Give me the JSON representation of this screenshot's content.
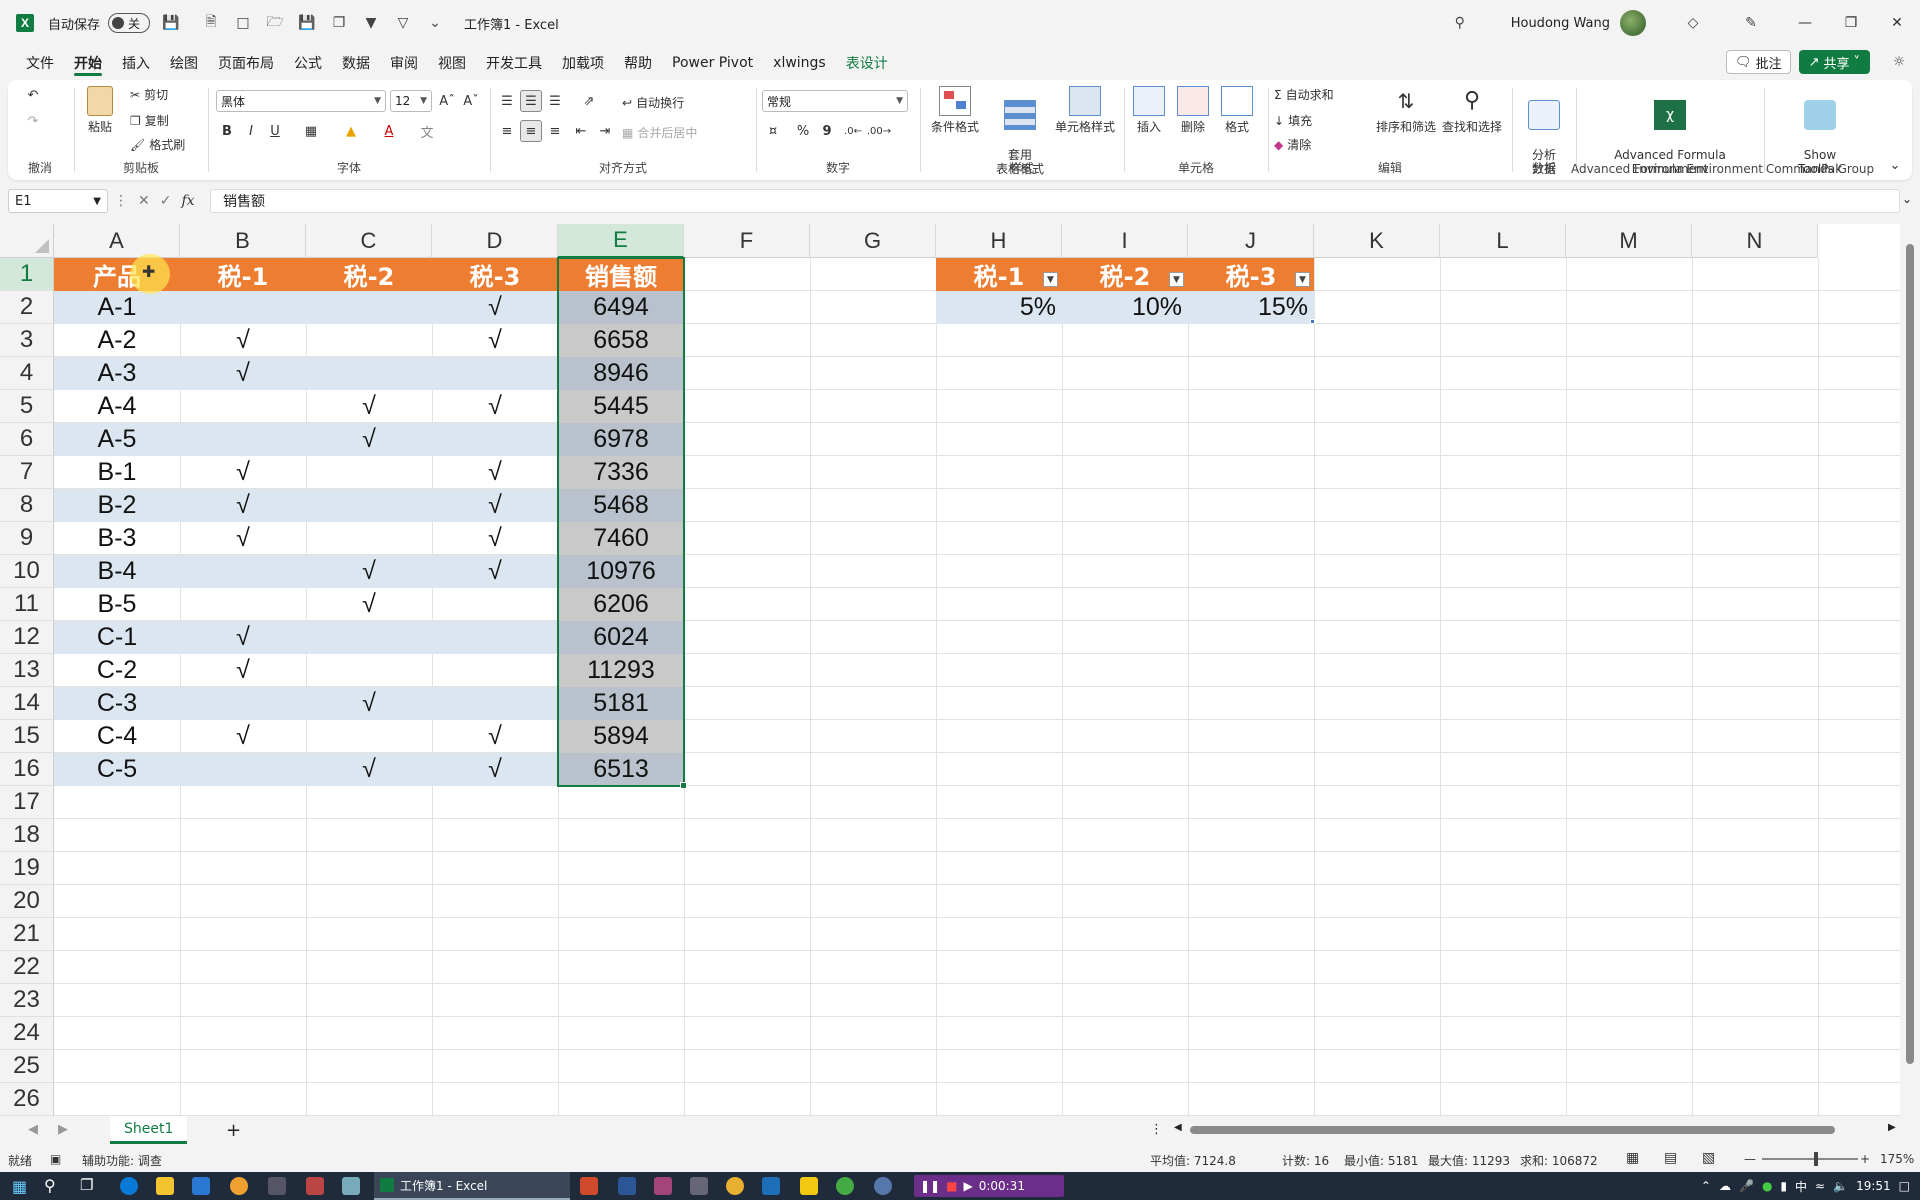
{
  "app": {
    "logo_letter": "X",
    "autosave_label": "自动保存",
    "autosave_state": "关",
    "doc_title": "工作簿1  -  Excel",
    "user_name": "Houdong Wang"
  },
  "menu_tabs": [
    {
      "label": "文件"
    },
    {
      "label": "开始"
    },
    {
      "label": "插入"
    },
    {
      "label": "绘图"
    },
    {
      "label": "页面布局"
    },
    {
      "label": "公式"
    },
    {
      "label": "数据"
    },
    {
      "label": "审阅"
    },
    {
      "label": "视图"
    },
    {
      "label": "开发工具"
    },
    {
      "label": "加载项"
    },
    {
      "label": "帮助"
    },
    {
      "label": "Power Pivot"
    },
    {
      "label": "xlwings"
    },
    {
      "label": "表设计"
    }
  ],
  "menu_right": {
    "comment_label": "批注",
    "share_label": "共享"
  },
  "ribbon": {
    "undo_group": "撤消",
    "clipboard": {
      "paste": "粘贴",
      "cut": "剪切",
      "copy": "复制",
      "format_painter": "格式刷",
      "label": "剪贴板"
    },
    "font": {
      "name": "黑体",
      "size": "12",
      "label": "字体",
      "bold": "B",
      "italic": "I",
      "underline": "U"
    },
    "alignment": {
      "wrap": "自动换行",
      "merge": "合并后居中",
      "label": "对齐方式"
    },
    "number": {
      "format": "常规",
      "percent": "%",
      "comma": "9",
      "label": "数字"
    },
    "styles": {
      "cond": "条件格式",
      "table": "套用\n表格格式",
      "cell_styles": "单元格样式",
      "label": "样式"
    },
    "cells": {
      "insert": "插入",
      "delete": "删除",
      "format": "格式",
      "label": "单元格"
    },
    "editing": {
      "autosum": "自动求和",
      "fill": "填充",
      "clear": "清除",
      "sort": "排序和筛选",
      "find": "查找和选择",
      "label": "编辑"
    },
    "analysis": {
      "btn": "分析\n数据",
      "label": "分析"
    },
    "afe": {
      "btn": "Advanced Formula\nEnvironment",
      "label": "Advanced Formula Environment"
    },
    "toolpak": {
      "btn": "Show\nToolPak",
      "label": "Commands Group"
    }
  },
  "formula_bar": {
    "name_box": "E1",
    "fx": "fx",
    "content": "销售额"
  },
  "columns": [
    "A",
    "B",
    "C",
    "D",
    "E",
    "F",
    "G",
    "H",
    "I",
    "J",
    "K",
    "L",
    "M",
    "N"
  ],
  "rows": [
    "1",
    "2",
    "3",
    "4",
    "5",
    "6",
    "7",
    "8",
    "9",
    "10",
    "11",
    "12",
    "13",
    "14",
    "15",
    "16",
    "17",
    "18",
    "19",
    "20",
    "21",
    "22",
    "23",
    "24",
    "25",
    "26"
  ],
  "table": {
    "headers": [
      "产品",
      "税-1",
      "税-2",
      "税-3",
      "销售额"
    ],
    "rows": [
      [
        "A-1",
        "",
        "",
        "√",
        "6494"
      ],
      [
        "A-2",
        "√",
        "",
        "√",
        "6658"
      ],
      [
        "A-3",
        "√",
        "",
        "",
        "8946"
      ],
      [
        "A-4",
        "",
        "√",
        "√",
        "5445"
      ],
      [
        "A-5",
        "",
        "√",
        "",
        "6978"
      ],
      [
        "B-1",
        "√",
        "",
        "√",
        "7336"
      ],
      [
        "B-2",
        "√",
        "",
        "√",
        "5468"
      ],
      [
        "B-3",
        "√",
        "",
        "√",
        "7460"
      ],
      [
        "B-4",
        "",
        "√",
        "√",
        "10976"
      ],
      [
        "B-5",
        "",
        "√",
        "",
        "6206"
      ],
      [
        "C-1",
        "√",
        "",
        "",
        "6024"
      ],
      [
        "C-2",
        "√",
        "",
        "",
        "11293"
      ],
      [
        "C-3",
        "",
        "√",
        "",
        "5181"
      ],
      [
        "C-4",
        "√",
        "",
        "√",
        "5894"
      ],
      [
        "C-5",
        "",
        "√",
        "√",
        "6513"
      ]
    ]
  },
  "rate_table": {
    "headers": [
      "税-1",
      "税-2",
      "税-3"
    ],
    "values": [
      "5%",
      "10%",
      "15%"
    ]
  },
  "sheet": {
    "tab": "Sheet1"
  },
  "status": {
    "ready": "就绪",
    "accessibility": "辅助功能: 调查",
    "average": "平均值: 7124.8",
    "count": "计数: 16",
    "min": "最小值: 5181",
    "max": "最大值: 11293",
    "sum": "求和: 106872",
    "zoom": "175%"
  },
  "taskbar": {
    "excel_task": "工作簿1 - Excel",
    "rec_time": "0:00:31",
    "ime": "中",
    "clock": "19:51"
  },
  "colors": {
    "accent": "#107c41",
    "header_orange": "#ed7d31",
    "band_blue": "#dce6f1"
  }
}
